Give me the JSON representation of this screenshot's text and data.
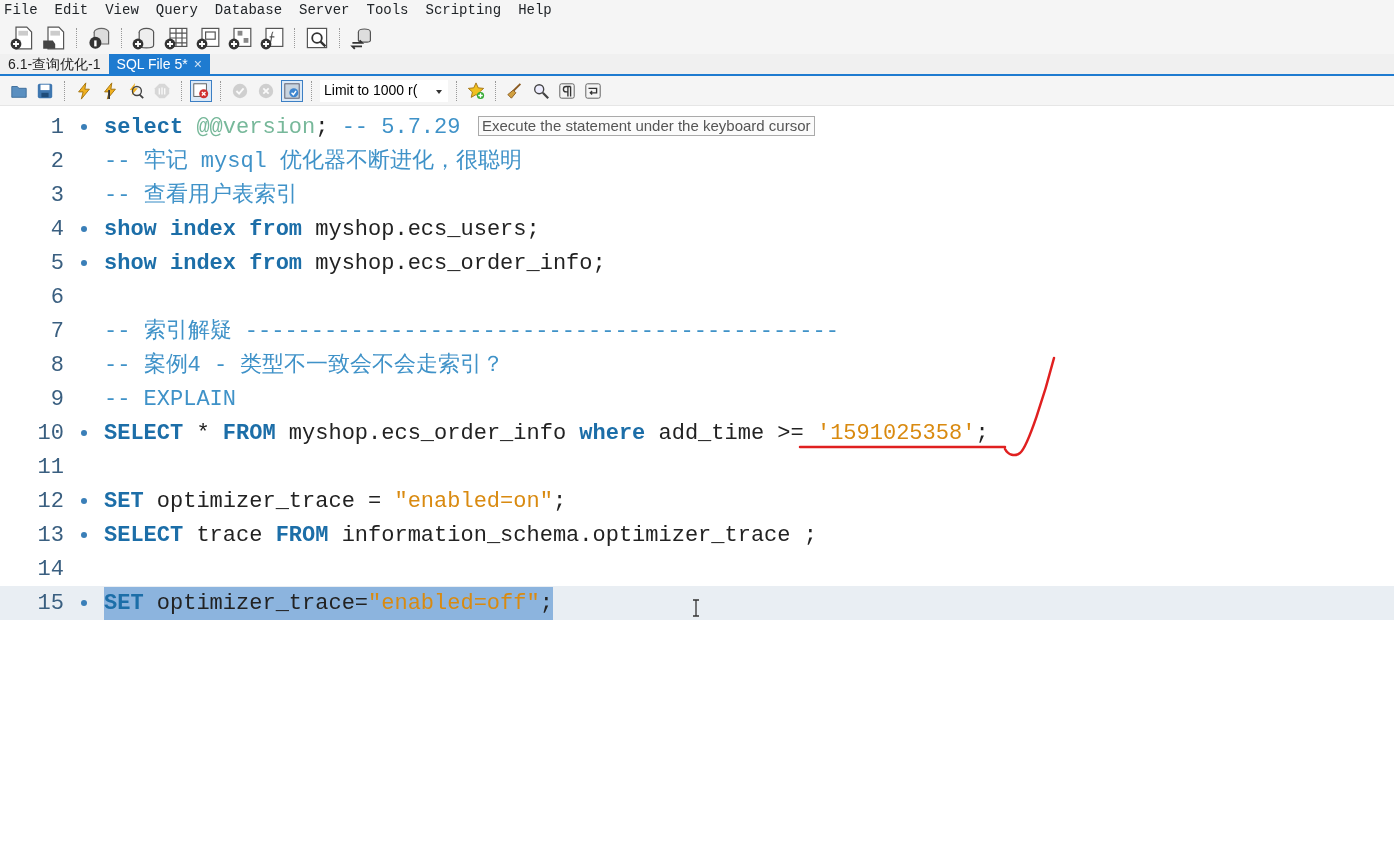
{
  "menu": [
    "File",
    "Edit",
    "View",
    "Query",
    "Database",
    "Server",
    "Tools",
    "Scripting",
    "Help"
  ],
  "main_toolbar": [
    {
      "kind": "sql-new"
    },
    {
      "kind": "sql-open"
    },
    {
      "kind": "sep"
    },
    {
      "kind": "info"
    },
    {
      "kind": "sep"
    },
    {
      "kind": "db-new"
    },
    {
      "kind": "table-new"
    },
    {
      "kind": "view-new"
    },
    {
      "kind": "proc-new"
    },
    {
      "kind": "func-new"
    },
    {
      "kind": "sep"
    },
    {
      "kind": "inspect"
    },
    {
      "kind": "sep"
    },
    {
      "kind": "reconnect"
    }
  ],
  "tabs": [
    {
      "label": "6.1-查询优化-1",
      "selected": false,
      "closable": false
    },
    {
      "label": "SQL File 5*",
      "selected": true,
      "closable": true,
      "close": "×"
    }
  ],
  "query_toolbar": [
    {
      "kind": "folder",
      "active": false,
      "disabled": false
    },
    {
      "kind": "save",
      "active": false,
      "disabled": false
    },
    {
      "kind": "sep"
    },
    {
      "kind": "bolt",
      "active": false,
      "disabled": false
    },
    {
      "kind": "bolt-cursor",
      "active": false,
      "disabled": false
    },
    {
      "kind": "explain",
      "active": false,
      "disabled": false
    },
    {
      "kind": "stop",
      "active": false,
      "disabled": true
    },
    {
      "kind": "sep"
    },
    {
      "kind": "toggle-error",
      "active": true,
      "disabled": false
    },
    {
      "kind": "sep"
    },
    {
      "kind": "commit",
      "active": false,
      "disabled": true
    },
    {
      "kind": "rollback",
      "active": false,
      "disabled": true
    },
    {
      "kind": "autocommit",
      "active": true,
      "disabled": false
    },
    {
      "kind": "sep"
    },
    {
      "kind": "limit",
      "value": "Limit to 1000 r("
    },
    {
      "kind": "sep"
    },
    {
      "kind": "snippet",
      "active": false,
      "disabled": false
    },
    {
      "kind": "sep"
    },
    {
      "kind": "beautify",
      "active": false,
      "disabled": false
    },
    {
      "kind": "find",
      "active": false,
      "disabled": false
    },
    {
      "kind": "invisible",
      "active": false,
      "disabled": false
    },
    {
      "kind": "wrap",
      "active": false,
      "disabled": false
    }
  ],
  "editor": {
    "lines": [
      {
        "number": "1",
        "statement": true,
        "selected": false,
        "tokens": [
          {
            "kind": "keyword",
            "text": "select "
          },
          {
            "kind": "variable",
            "text": "@@version"
          },
          {
            "kind": "plain",
            "text": "; "
          },
          {
            "kind": "comment",
            "text": "-- 5.7.29"
          }
        ]
      },
      {
        "number": "2",
        "statement": false,
        "selected": false,
        "tokens": [
          {
            "kind": "comment",
            "text": "-- 牢记 mysql 优化器不断进化，很聪明"
          }
        ]
      },
      {
        "number": "3",
        "statement": false,
        "selected": false,
        "tokens": [
          {
            "kind": "comment",
            "text": "-- 查看用户表索引"
          }
        ]
      },
      {
        "number": "4",
        "statement": true,
        "selected": false,
        "tokens": [
          {
            "kind": "keyword",
            "text": "show "
          },
          {
            "kind": "keyword",
            "text": "index "
          },
          {
            "kind": "keyword",
            "text": "from"
          },
          {
            "kind": "plain",
            "text": " myshop.ecs_users;"
          }
        ]
      },
      {
        "number": "5",
        "statement": true,
        "selected": false,
        "tokens": [
          {
            "kind": "keyword",
            "text": "show "
          },
          {
            "kind": "keyword",
            "text": "index "
          },
          {
            "kind": "keyword",
            "text": "from"
          },
          {
            "kind": "plain",
            "text": " myshop.ecs_order_info;"
          }
        ]
      },
      {
        "number": "6",
        "statement": false,
        "selected": false
      },
      {
        "number": "7",
        "statement": false,
        "selected": false,
        "tokens": [
          {
            "kind": "comment",
            "text": "-- 索引解疑 ---------------------------------------------"
          }
        ]
      },
      {
        "number": "8",
        "statement": false,
        "selected": false,
        "tokens": [
          {
            "kind": "comment",
            "text": "-- 案例4 - 类型不一致会不会走索引？"
          }
        ]
      },
      {
        "number": "9",
        "statement": false,
        "selected": false,
        "tokens": [
          {
            "kind": "comment",
            "text": "-- EXPLAIN"
          }
        ]
      },
      {
        "number": "10",
        "statement": true,
        "selected": false,
        "tokens": [
          {
            "kind": "keyword",
            "text": "SELECT"
          },
          {
            "kind": "plain",
            "text": " * "
          },
          {
            "kind": "keyword",
            "text": "FROM"
          },
          {
            "kind": "plain",
            "text": " myshop.ecs_order_info "
          },
          {
            "kind": "keyword",
            "text": "where"
          },
          {
            "kind": "plain",
            "text": " add_time >= "
          },
          {
            "kind": "string",
            "text": "'1591025358'"
          },
          {
            "kind": "plain",
            "text": ";"
          }
        ]
      },
      {
        "number": "11",
        "statement": false,
        "selected": false
      },
      {
        "number": "12",
        "statement": true,
        "selected": false,
        "tokens": [
          {
            "kind": "keyword",
            "text": "SET"
          },
          {
            "kind": "plain",
            "text": " optimizer_trace = "
          },
          {
            "kind": "string",
            "text": "\"enabled=on\""
          },
          {
            "kind": "plain",
            "text": ";"
          }
        ]
      },
      {
        "number": "13",
        "statement": true,
        "selected": false,
        "tokens": [
          {
            "kind": "keyword",
            "text": "SELECT"
          },
          {
            "kind": "plain",
            "text": " trace "
          },
          {
            "kind": "keyword",
            "text": "FROM"
          },
          {
            "kind": "plain",
            "text": " information_schema.optimizer_trace ;"
          }
        ]
      },
      {
        "number": "14",
        "statement": false,
        "selected": false
      },
      {
        "number": "15",
        "statement": true,
        "selected": true,
        "tokens": [
          {
            "kind": "keyword",
            "text": "SET"
          },
          {
            "kind": "plain",
            "text": " optimizer_trace="
          },
          {
            "kind": "string",
            "text": "\"enabled=off\""
          },
          {
            "kind": "plain",
            "text": ";"
          }
        ]
      }
    ]
  },
  "tooltip": "Execute the statement under the keyboard cursor"
}
